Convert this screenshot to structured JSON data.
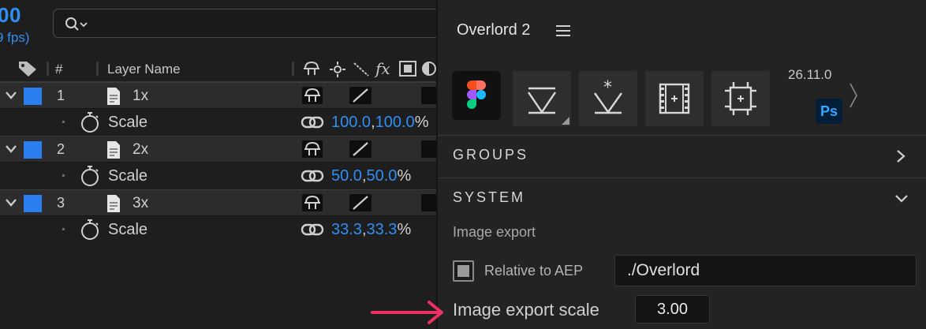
{
  "timeline": {
    "timecode": "00",
    "fps": "9 fps)",
    "columns": {
      "hash": "#",
      "layer_name": "Layer Name"
    },
    "layers": [
      {
        "num": "1",
        "name": "1x",
        "prop": "Scale",
        "val_a": "100.0",
        "val_b": "100.0",
        "unit": "%"
      },
      {
        "num": "2",
        "name": "2x",
        "prop": "Scale",
        "val_a": "50.0",
        "val_b": "50.0",
        "unit": "%"
      },
      {
        "num": "3",
        "name": "3x",
        "prop": "Scale",
        "val_a": "33.3",
        "val_b": "33.3",
        "unit": "%"
      }
    ],
    "comma": ",",
    "fx_label": "fx",
    "swatch_color": "#2a7ef0"
  },
  "panel": {
    "title": "Overlord 2",
    "version": "26.11.0",
    "ps_badge": "Ps",
    "tools": [
      "figma-icon",
      "triangle-tool-icon",
      "spark-tool-icon",
      "film-frame-icon",
      "artboard-icon"
    ],
    "sections": {
      "groups": "GROUPS",
      "system": "SYSTEM"
    },
    "image_export_heading": "Image export",
    "relative_label": "Relative to AEP",
    "relative_checked": true,
    "export_path": "./Overlord",
    "scale_label": "Image export scale",
    "scale_value": "3.00"
  },
  "colors": {
    "accent_blue": "#2f8ff5",
    "arrow": "#ee2f62"
  }
}
